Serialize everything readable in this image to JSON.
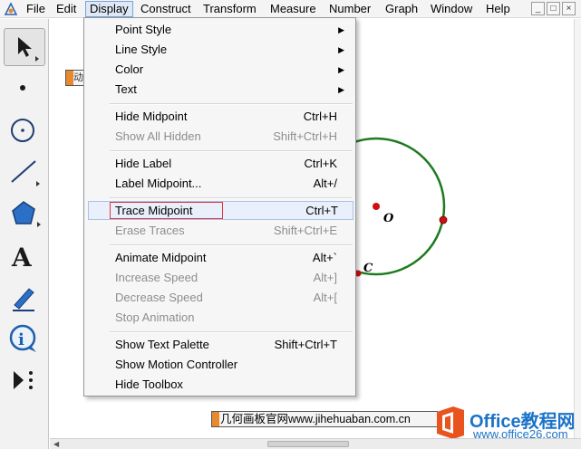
{
  "menubar": {
    "items": [
      "File",
      "Edit",
      "Display",
      "Construct",
      "Transform",
      "Measure",
      "Number",
      "Graph",
      "Window",
      "Help"
    ],
    "active": "Display",
    "window_buttons": [
      "_",
      "□",
      "×"
    ]
  },
  "toolbox": {
    "tools": [
      "arrow-select-tool",
      "point-tool",
      "compass-tool",
      "straightedge-tool",
      "polygon-tool",
      "text-tool",
      "marker-tool",
      "information-tool",
      "custom-tool"
    ]
  },
  "canvas": {
    "label_o": "O",
    "label_c": "C",
    "orange_tag_text": "动",
    "bottom_tag_text": "几何画板官网www.jihehuaban.com.cn",
    "circle_color": "#1e7a1e",
    "point_color": "#d01010"
  },
  "watermark": {
    "brand": "Office教程网",
    "url": "www.office26.com"
  },
  "display_menu": {
    "groups": [
      [
        {
          "label": "Point Style",
          "shortcut": "",
          "submenu": true,
          "enabled": true
        },
        {
          "label": "Line Style",
          "shortcut": "",
          "submenu": true,
          "enabled": true
        },
        {
          "label": "Color",
          "shortcut": "",
          "submenu": true,
          "enabled": true
        },
        {
          "label": "Text",
          "shortcut": "",
          "submenu": true,
          "enabled": true
        }
      ],
      [
        {
          "label": "Hide Midpoint",
          "shortcut": "Ctrl+H",
          "enabled": true
        },
        {
          "label": "Show All Hidden",
          "shortcut": "Shift+Ctrl+H",
          "enabled": false
        }
      ],
      [
        {
          "label": "Hide Label",
          "shortcut": "Ctrl+K",
          "enabled": true
        },
        {
          "label": "Label Midpoint...",
          "shortcut": "Alt+/",
          "enabled": true
        }
      ],
      [
        {
          "label": "Trace Midpoint",
          "shortcut": "Ctrl+T",
          "enabled": true,
          "highlighted": true
        },
        {
          "label": "Erase Traces",
          "shortcut": "Shift+Ctrl+E",
          "enabled": false
        }
      ],
      [
        {
          "label": "Animate Midpoint",
          "shortcut": "Alt+`",
          "enabled": true
        },
        {
          "label": "Increase Speed",
          "shortcut": "Alt+]",
          "enabled": false
        },
        {
          "label": "Decrease Speed",
          "shortcut": "Alt+[",
          "enabled": false
        },
        {
          "label": "Stop Animation",
          "shortcut": "",
          "enabled": false
        }
      ],
      [
        {
          "label": "Show Text Palette",
          "shortcut": "Shift+Ctrl+T",
          "enabled": true
        },
        {
          "label": "Show Motion Controller",
          "shortcut": "",
          "enabled": true
        },
        {
          "label": "Hide Toolbox",
          "shortcut": "",
          "enabled": true
        }
      ]
    ]
  },
  "colors": {
    "menu_highlight_border": "#e0353b",
    "accent_blue": "#1b73c8",
    "tag_orange": "#e8892e"
  }
}
